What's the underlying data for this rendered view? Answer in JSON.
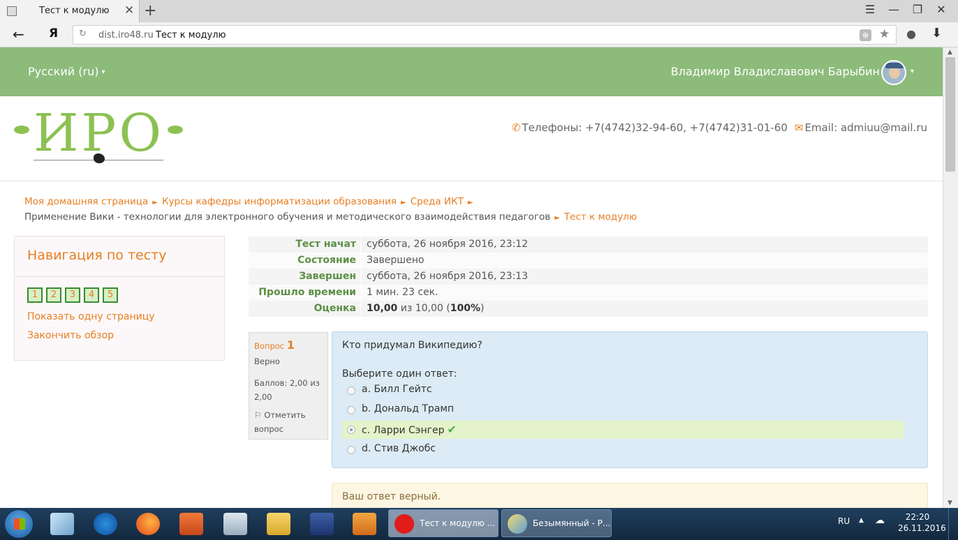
{
  "browser": {
    "tab_title": "Тест к модулю",
    "tab_close": "✕",
    "new_tab": "+",
    "win_menu": "☰",
    "win_min": "—",
    "win_restore": "❐",
    "win_close": "✕",
    "back": "←",
    "yandex_logo": "Я",
    "reload": "↻",
    "address_host": "dist.iro48.ru",
    "address_title": "Тест к модулю",
    "protect_icon": "⊕",
    "bookmark_icon": "★",
    "ext_icon": "●",
    "download_icon": "⬇"
  },
  "topbar": {
    "language": "Русский (ru)",
    "caret": "▾",
    "user_name": "Владимир Владиславович Барыбин",
    "accent": "#8cbb7a"
  },
  "header": {
    "logo_text": "ИРО",
    "phones_label": "Телефоны: +7(4742)32-94-60, +7(4742)31-01-60",
    "email_label": "Email: admiuu@mail.ru",
    "phone_icon": "✆",
    "email_icon": "✉"
  },
  "breadcrumb": {
    "items": [
      "Моя домашняя страница",
      "Курсы кафедры информатизации образования",
      "Среда ИКТ",
      "Применение Вики - технологии для электронного обучения и методического взаимодействия педагогов",
      "Тест к модулю"
    ],
    "separator": "►"
  },
  "quiz_nav": {
    "title": "Навигация по тесту",
    "questions": [
      "1",
      "2",
      "3",
      "4",
      "5"
    ],
    "show_one_page": "Показать одну страницу",
    "finish_review": "Закончить обзор"
  },
  "summary": {
    "rows": [
      {
        "label": "Тест начат",
        "value": "суббота, 26 ноября 2016, 23:12"
      },
      {
        "label": "Состояние",
        "value": "Завершено"
      },
      {
        "label": "Завершен",
        "value": "суббота, 26 ноября 2016, 23:13"
      },
      {
        "label": "Прошло времени",
        "value": "1 мин. 23 сек."
      },
      {
        "label": "Оценка",
        "grade": "10,00",
        "of": "из 10,00 (",
        "percent": "100%",
        "close": ")"
      }
    ]
  },
  "question": {
    "label": "Вопрос",
    "number": "1",
    "state": "Верно",
    "marks": "Баллов: 2,00 из 2,00",
    "flag_icon": "⚐",
    "flag_label": "Отметить вопрос",
    "text": "Кто придумал Википедию?",
    "prompt": "Выберите один ответ:",
    "answers": [
      {
        "text": "a. Билл Гейтс",
        "selected": false
      },
      {
        "text": "b. Дональд Трамп",
        "selected": false
      },
      {
        "text": "c. Ларри Сэнгер",
        "selected": true,
        "correct": true
      },
      {
        "text": "d. Стив Джобс",
        "selected": false
      }
    ],
    "check_icon": "✔",
    "feedback": "Ваш ответ верный."
  },
  "taskbar": {
    "tasks": [
      {
        "label": "Тест к модулю ...",
        "active": true
      },
      {
        "label": "Безымянный - Р...",
        "active": false
      }
    ],
    "tray_lang": "RU",
    "tray_arrow": "▲",
    "tray_net": "☁",
    "time": "22:20",
    "date": "26.11.2016"
  },
  "scrollbar": {
    "up": "▲",
    "down": "▼"
  }
}
